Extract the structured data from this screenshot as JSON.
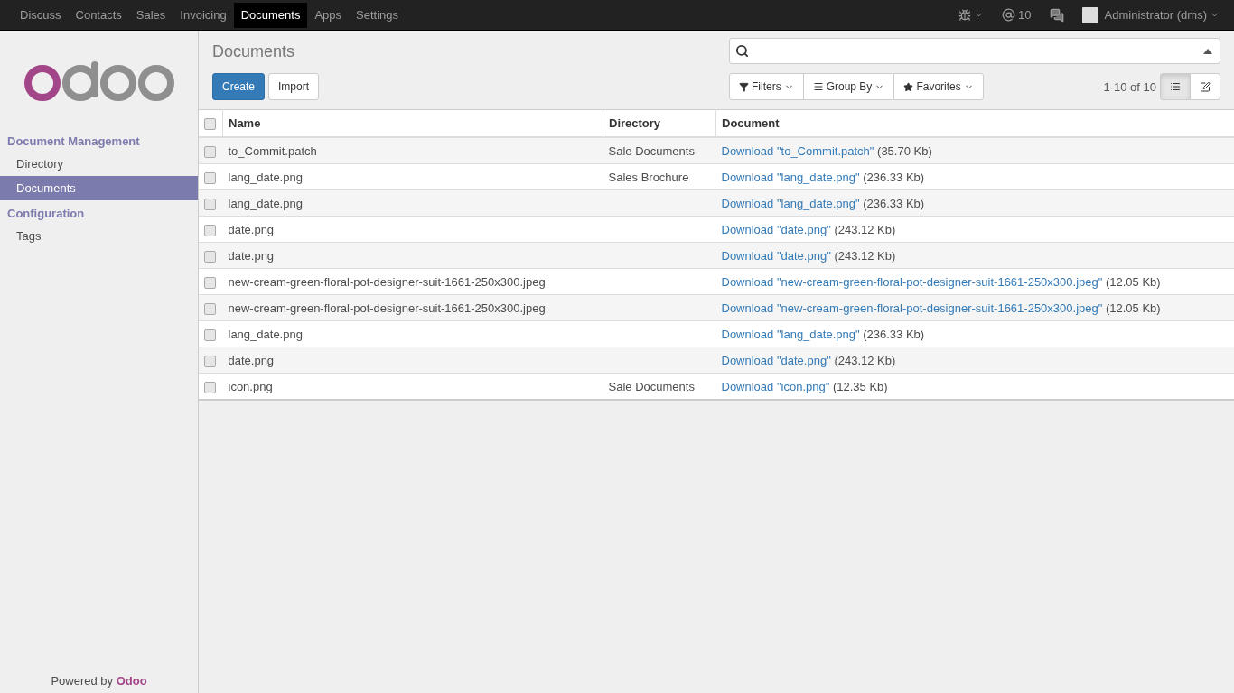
{
  "top_menu": [
    {
      "label": "Discuss",
      "selected": false
    },
    {
      "label": "Contacts",
      "selected": false
    },
    {
      "label": "Sales",
      "selected": false
    },
    {
      "label": "Invoicing",
      "selected": false
    },
    {
      "label": "Documents",
      "selected": true
    },
    {
      "label": "Apps",
      "selected": false
    },
    {
      "label": "Settings",
      "selected": false
    }
  ],
  "systray": {
    "mentions": "10",
    "user": "Administrator (dms)"
  },
  "sidebar": {
    "sections": [
      {
        "label": "Document Management",
        "children": [
          {
            "label": "Directory",
            "selected": false
          },
          {
            "label": "Documents",
            "selected": true
          }
        ]
      },
      {
        "label": "Configuration",
        "children": [
          {
            "label": "Tags",
            "selected": false
          }
        ]
      }
    ],
    "footer_prefix": "Powered by",
    "footer_brand": "Odoo"
  },
  "breadcrumb": "Documents",
  "buttons": {
    "create": "Create",
    "import": "Import"
  },
  "search_buttons": [
    "Filters",
    "Group By",
    "Favorites"
  ],
  "pager": "1-10 of 10",
  "views": [
    {
      "kind": "list",
      "selected": true
    },
    {
      "kind": "form",
      "selected": false
    }
  ],
  "table": {
    "select_all_checked": false,
    "columns": [
      "Name",
      "Directory",
      "Document"
    ],
    "rows": [
      {
        "name": "to_Commit.patch",
        "directory": "Sale Documents",
        "link": "Download \"to_Commit.patch\"",
        "size": "(35.70 Kb)",
        "checked": false
      },
      {
        "name": "lang_date.png",
        "directory": "Sales Brochure",
        "link": "Download \"lang_date.png\"",
        "size": "(236.33 Kb)",
        "checked": false
      },
      {
        "name": "lang_date.png",
        "link": "Download \"lang_date.png\"",
        "size": "(236.33 Kb)",
        "checked": false
      },
      {
        "name": "date.png",
        "link": "Download \"date.png\"",
        "size": "(243.12 Kb)",
        "checked": false
      },
      {
        "name": "date.png",
        "link": "Download \"date.png\"",
        "size": "(243.12 Kb)",
        "checked": false
      },
      {
        "name": "new-cream-green-floral-pot-designer-suit-1661-250x300.jpeg",
        "link": "Download \"new-cream-green-floral-pot-designer-suit-1661-250x300.jpeg\"",
        "size": "(12.05 Kb)",
        "checked": false
      },
      {
        "name": "new-cream-green-floral-pot-designer-suit-1661-250x300.jpeg",
        "link": "Download \"new-cream-green-floral-pot-designer-suit-1661-250x300.jpeg\"",
        "size": "(12.05 Kb)",
        "checked": false
      },
      {
        "name": "lang_date.png",
        "link": "Download \"lang_date.png\"",
        "size": "(236.33 Kb)",
        "checked": false
      },
      {
        "name": "date.png",
        "link": "Download \"date.png\"",
        "size": "(243.12 Kb)",
        "checked": false
      },
      {
        "name": "icon.png",
        "directory": "Sale Documents",
        "link": "Download \"icon.png\"",
        "size": "(12.35 Kb)",
        "checked": false
      }
    ]
  }
}
